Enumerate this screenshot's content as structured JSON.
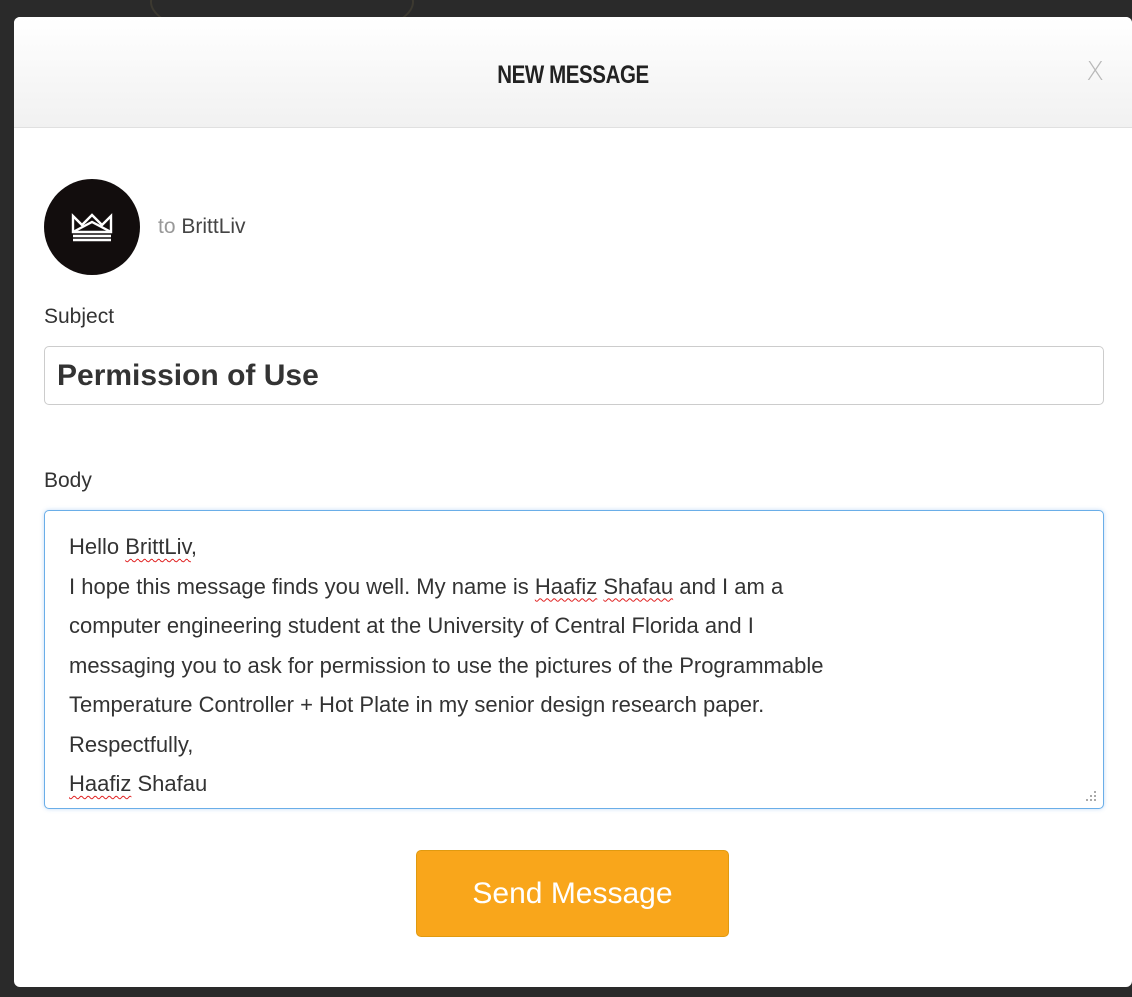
{
  "modal": {
    "title": "NEW MESSAGE",
    "close_label": "X"
  },
  "recipient": {
    "prefix": "to",
    "name": "BrittLiv",
    "avatar_icon": "crown-icon"
  },
  "subject": {
    "label": "Subject",
    "value": "Permission of Use"
  },
  "body": {
    "label": "Body",
    "lines": [
      [
        {
          "text": "Hello "
        },
        {
          "text": "BrittLiv",
          "misspelled": true
        },
        {
          "text": ","
        }
      ],
      [
        {
          "text": "I hope this message finds you well. My name is "
        },
        {
          "text": "Haafiz",
          "misspelled": true
        },
        {
          "text": " "
        },
        {
          "text": "Shafau",
          "misspelled": true
        },
        {
          "text": " and I am a"
        }
      ],
      [
        {
          "text": "computer engineering student at the University of Central Florida and I"
        }
      ],
      [
        {
          "text": "messaging you to ask for permission to use the pictures of the Programmable"
        }
      ],
      [
        {
          "text": "Temperature Controller + Hot Plate in my senior design research paper."
        }
      ],
      [
        {
          "text": "Respectfully,"
        }
      ],
      [
        {
          "text": "Haafiz",
          "misspelled": true
        },
        {
          "text": " Shafau"
        }
      ]
    ]
  },
  "actions": {
    "send_label": "Send Message"
  },
  "colors": {
    "send_button": "#f9a61b",
    "avatar_bg": "#120d0d",
    "focus_border": "#6aaee8",
    "spellcheck": "#e02020"
  }
}
